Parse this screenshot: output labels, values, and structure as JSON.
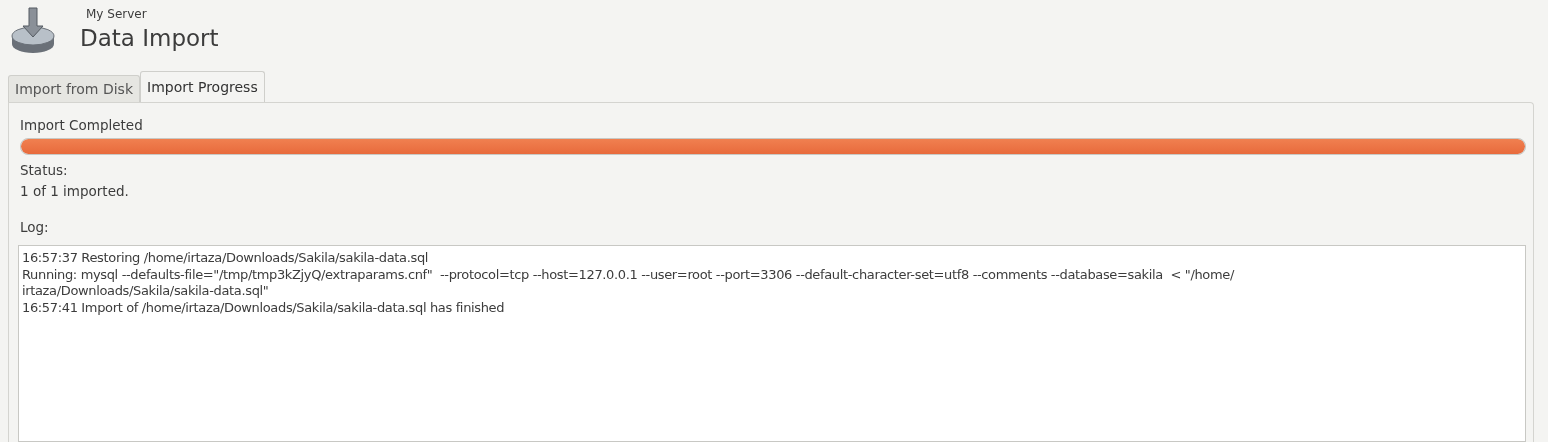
{
  "header": {
    "subtitle": "My Server",
    "title": "Data Import"
  },
  "tabs": [
    {
      "label": "Import from Disk",
      "selected": false
    },
    {
      "label": "Import Progress",
      "selected": true
    }
  ],
  "progress": {
    "label": "Import Completed",
    "level": 1.0
  },
  "status": {
    "label": "Status:",
    "value": "1 of 1 imported."
  },
  "log": {
    "label": "Log:",
    "lines": [
      "16:57:37 Restoring /home/irtaza/Downloads/Sakila/sakila-data.sql",
      "Running: mysql --defaults-file=\"/tmp/tmp3kZjyQ/extraparams.cnf\"  --protocol=tcp --host=127.0.0.1 --user=root --port=3306 --default-character-set=utf8 --comments --database=sakila  < \"/home/",
      "irtaza/Downloads/Sakila/sakila-data.sql\"",
      "16:57:41 Import of /home/irtaza/Downloads/Sakila/sakila-data.sql has finished"
    ]
  }
}
